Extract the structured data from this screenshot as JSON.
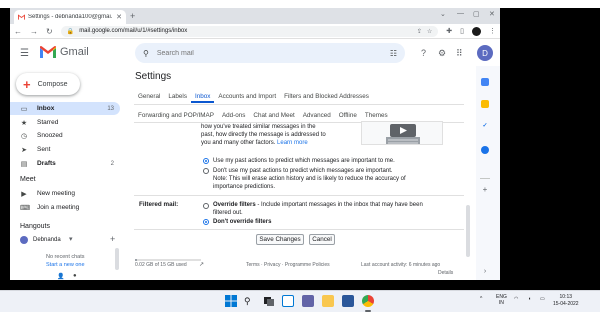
{
  "browser": {
    "tab_title": "Settings - debnanda100@gmai...",
    "url": "mail.google.com/mail/u/1/#settings/inbox",
    "colors": {
      "frame": "#dee1e6",
      "omnibox": "#f1f3f4"
    }
  },
  "gmail": {
    "brand": "Gmail",
    "search_placeholder": "Search mail",
    "avatar_letter": "D",
    "compose_label": "Compose",
    "nav": [
      {
        "label": "Inbox",
        "count": "13",
        "icon": "inbox-icon"
      },
      {
        "label": "Starred",
        "count": "",
        "icon": "star-icon"
      },
      {
        "label": "Snoozed",
        "count": "",
        "icon": "clock-icon"
      },
      {
        "label": "Sent",
        "count": "",
        "icon": "send-icon"
      },
      {
        "label": "Drafts",
        "count": "2",
        "icon": "draft-icon"
      }
    ],
    "meet": {
      "heading": "Meet",
      "items": [
        {
          "label": "New meeting",
          "icon": "video-icon"
        },
        {
          "label": "Join a meeting",
          "icon": "keyboard-icon"
        }
      ]
    },
    "hangouts": {
      "heading": "Hangouts",
      "user": "Debnanda",
      "no_chats": "No recent chats",
      "start_new": "Start a new one"
    },
    "colors": {
      "active_nav": "#d3e3fd",
      "accent": "#0b57d0",
      "link": "#1a73e8"
    }
  },
  "settings": {
    "title": "Settings",
    "tabs_row1": [
      "General",
      "Labels",
      "Inbox",
      "Accounts and Import",
      "Filters and Blocked Addresses"
    ],
    "tabs_row2": [
      "Forwarding and POP/IMAP",
      "Add-ons",
      "Chat and Meet",
      "Advanced",
      "Offline",
      "Themes"
    ],
    "active_tab": "Inbox",
    "intro_lines": [
      "how you've treated similar messages in the",
      "past, how directly the message is addressed to",
      "you and many other factors."
    ],
    "learn_more": "Learn more",
    "importance": {
      "opt1": "Use my past actions to predict which messages are important to me.",
      "opt2": "Don't use my past actions to predict which messages are important.",
      "note1": "Note: This will erase action history and is likely to reduce the accuracy of",
      "note2": "importance predictions."
    },
    "filtered_mail": {
      "label": "Filtered mail:",
      "opt1_bold": "Override filters",
      "opt1_rest": " - Include important messages in the inbox that may have been",
      "opt1_line2": "filtered out.",
      "opt2": "Don't override filters"
    },
    "buttons": {
      "save": "Save Changes",
      "cancel": "Cancel"
    },
    "footer": {
      "storage": "0.02 GB of 15 GB used",
      "storage_fraction": 0.0013,
      "links": "Terms · Privacy · Programme Policies",
      "activity": "Last account activity: 6 minutes ago",
      "details": "Details"
    }
  },
  "taskbar": {
    "lang1": "ENG",
    "lang2": "IN",
    "time": "10:13",
    "date": "15-04-2022"
  }
}
